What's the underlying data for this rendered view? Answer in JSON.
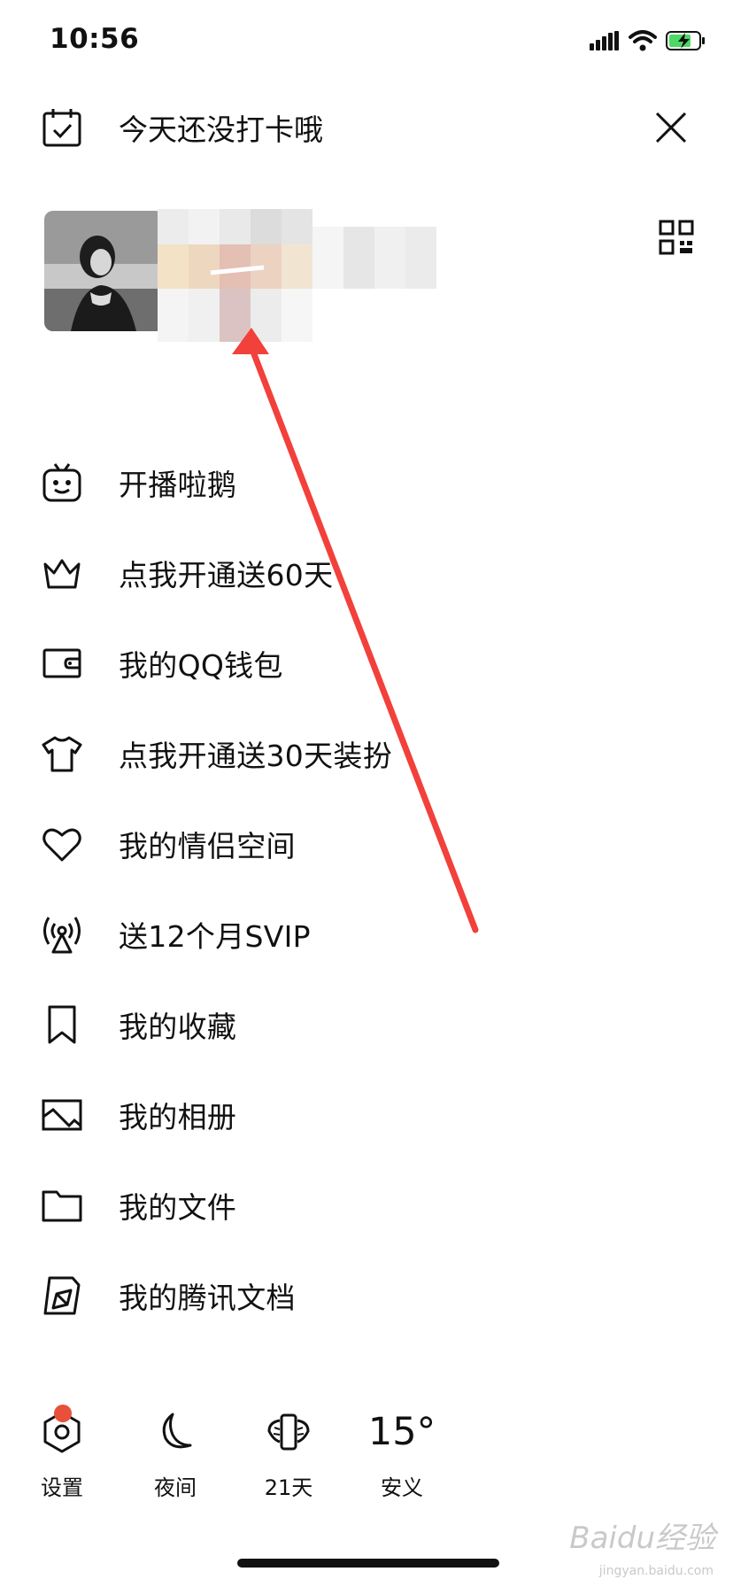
{
  "status_bar": {
    "time": "10:56",
    "icons": [
      "cellular-signal-icon",
      "wifi-icon",
      "battery-charging-icon"
    ]
  },
  "header": {
    "checkin_text": "今天还没打卡哦",
    "checkin_icon": "calendar-check-icon",
    "close_icon": "close-icon"
  },
  "profile": {
    "avatar_icon": "avatar",
    "qr_icon": "qr-code-icon"
  },
  "menu": [
    {
      "label": "开播啦鹅",
      "icon": "tv-face-icon"
    },
    {
      "label": "点我开通送60天",
      "icon": "crown-icon"
    },
    {
      "label": "我的QQ钱包",
      "icon": "wallet-icon"
    },
    {
      "label": "点我开通送30天装扮",
      "icon": "tshirt-icon"
    },
    {
      "label": "我的情侣空间",
      "icon": "heart-icon"
    },
    {
      "label": "送12个月SVIP",
      "icon": "broadcast-icon"
    },
    {
      "label": "我的收藏",
      "icon": "bookmark-icon"
    },
    {
      "label": "我的相册",
      "icon": "image-icon"
    },
    {
      "label": "我的文件",
      "icon": "folder-icon"
    },
    {
      "label": "我的腾讯文档",
      "icon": "document-icon"
    }
  ],
  "bottom_bar": {
    "settings": {
      "label": "设置",
      "icon": "hexagon-gear-icon"
    },
    "night": {
      "label": "夜间",
      "icon": "moon-icon"
    },
    "days": {
      "label": "21天",
      "icon": "wings-badge-icon"
    },
    "weather": {
      "temp": "15°",
      "location": "安义"
    }
  },
  "watermark": {
    "text": "Baidu经验",
    "sub": "jingyan.baidu.com"
  },
  "colors": {
    "accent_arrow": "#f2403b",
    "badge": "#e8503a",
    "battery": "#4cd964"
  }
}
